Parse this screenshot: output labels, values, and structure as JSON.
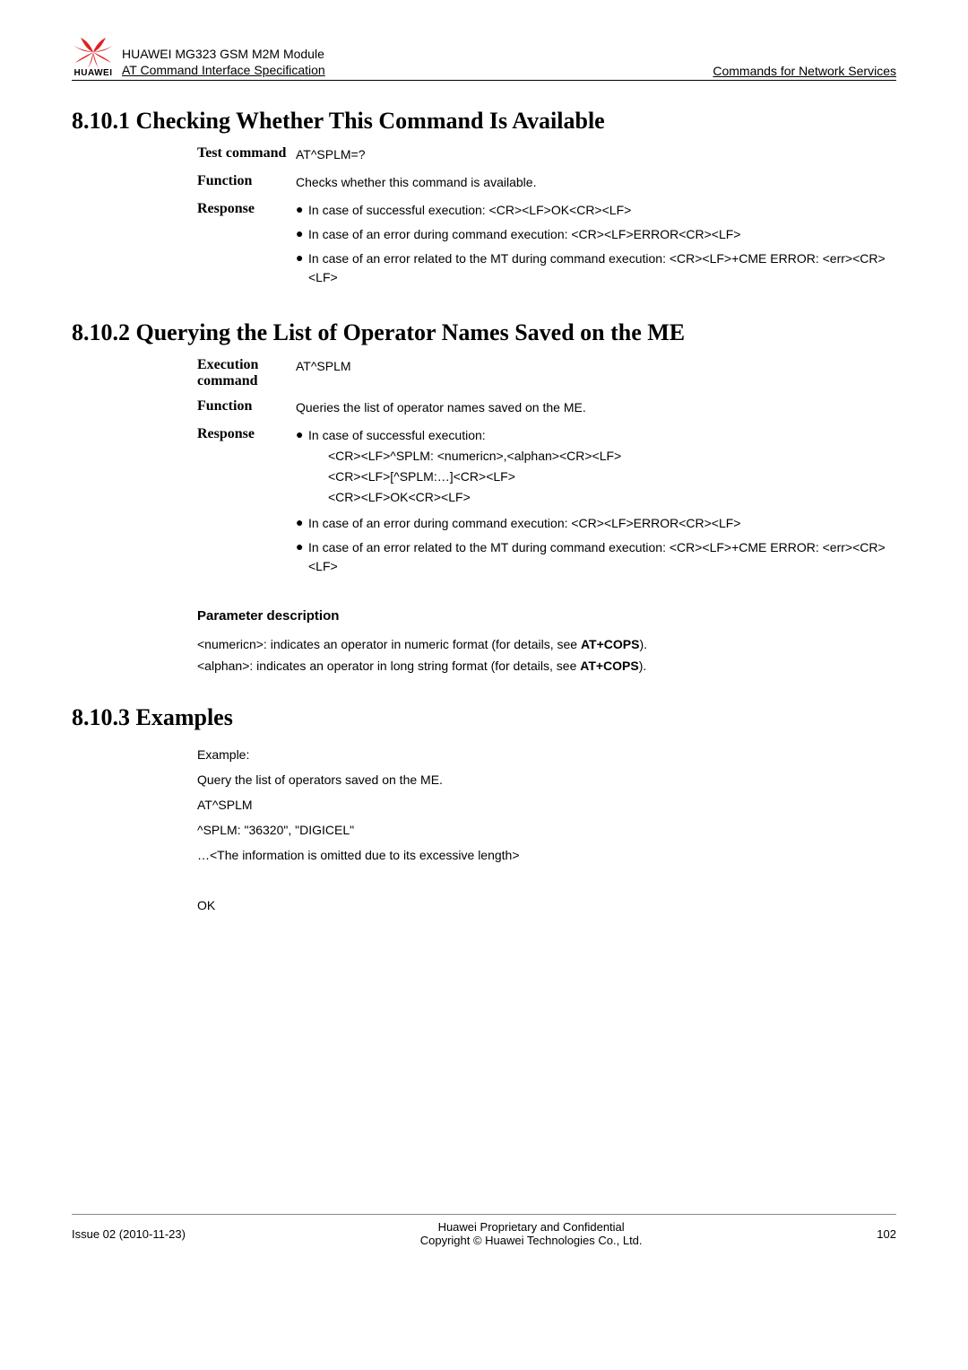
{
  "header": {
    "product": "HUAWEI MG323 GSM M2M Module",
    "doc": "AT Command Interface Specification",
    "chapter": "Commands for Network Services",
    "brand": "HUAWEI"
  },
  "s1": {
    "heading": "8.10.1 Checking Whether This Command Is Available",
    "rows": [
      {
        "label": "Test command",
        "text": "AT^SPLM=?"
      },
      {
        "label": "Function",
        "text": "Checks whether this command is available."
      }
    ],
    "response_label": "Response",
    "response_bullets": [
      {
        "main": "In case of successful execution:   <CR><LF>OK<CR><LF>"
      },
      {
        "main": "In case of an error during command execution: <CR><LF>ERROR<CR><LF>"
      },
      {
        "main": "In case of an error related to the MT during command execution: <CR><LF>+CME ERROR: <err><CR><LF>"
      }
    ]
  },
  "s2": {
    "heading": "8.10.2 Querying the List of Operator Names Saved on the ME",
    "rows": [
      {
        "label": "Execution command",
        "text": "AT^SPLM"
      },
      {
        "label": "Function",
        "text": "Queries the list of operator names saved on the ME."
      }
    ],
    "response_label": "Response",
    "resp1_intro": "In case of successful execution:",
    "resp1_lines": [
      "<CR><LF>^SPLM: <numericn>,<alphan><CR><LF>",
      "<CR><LF>[^SPLM:…]<CR><LF>",
      "<CR><LF>OK<CR><LF>"
    ],
    "resp_other": [
      {
        "main": "In case of an error during command execution: <CR><LF>ERROR<CR><LF>"
      },
      {
        "main": "In case of an error related to the MT during command execution: <CR><LF>+CME ERROR: <err><CR><LF>"
      }
    ],
    "paramHeading": "Parameter description",
    "param1_a": "<numericn>: indicates an operator in numeric format (for details, see ",
    "param1_b": "AT+COPS",
    "param1_c": ").",
    "param2_a": "<alphan>: indicates an operator in long string format (for details, see ",
    "param2_b": "AT+COPS",
    "param2_c": ")."
  },
  "s3": {
    "heading": "8.10.3 Examples",
    "lines": [
      "Example:",
      "Query the list of operators saved on the ME.",
      "AT^SPLM",
      "^SPLM: \"36320\", \"DIGICEL\"",
      "…<The information is omitted due to its excessive length>",
      "",
      "OK"
    ]
  },
  "footer": {
    "left": "Issue 02 (2010-11-23)",
    "center1": "Huawei Proprietary and Confidential",
    "center2": "Copyright © Huawei Technologies Co., Ltd.",
    "right": "102"
  }
}
